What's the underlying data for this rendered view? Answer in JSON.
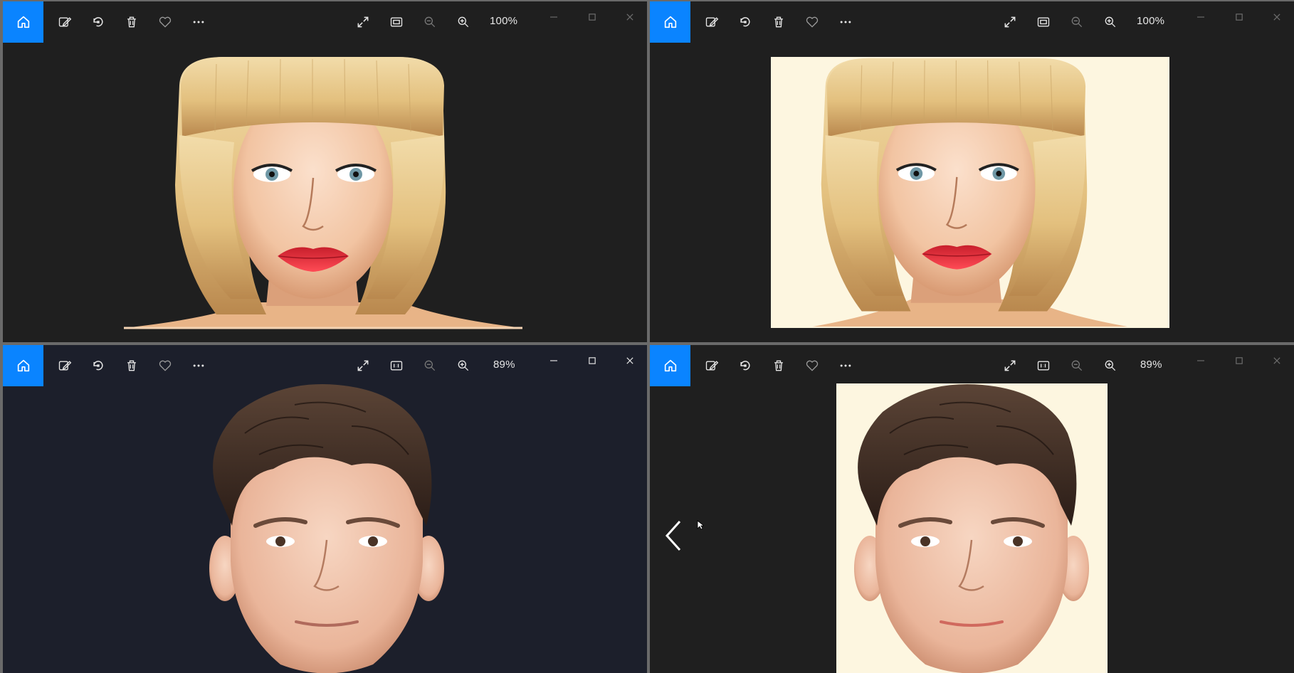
{
  "windows": [
    {
      "id": "top-left",
      "zoom": "100%",
      "background": "#1f1f1f",
      "photo_background": "none",
      "subject": "blonde woman bob haircut",
      "max_style": "dim"
    },
    {
      "id": "top-right",
      "zoom": "100%",
      "background": "#1f1f1f",
      "photo_background": "#fdf6e0",
      "subject": "blonde woman bob haircut",
      "max_style": "dim"
    },
    {
      "id": "bottom-left",
      "zoom": "89%",
      "background": "#1c1f2b",
      "photo_background": "none",
      "subject": "young man brown hair",
      "max_style": "bright"
    },
    {
      "id": "bottom-right",
      "zoom": "89%",
      "background": "#1f1f1f",
      "photo_background": "#fdf6e0",
      "subject": "young man brown hair",
      "max_style": "dim"
    }
  ],
  "toolbar": {
    "icons": [
      "home-icon",
      "edit-image-icon",
      "rotate-icon",
      "delete-icon",
      "favorite-icon",
      "more-icon",
      "fullscreen-icon",
      "fit-icon",
      "zoom-out-icon",
      "zoom-in-icon"
    ]
  },
  "colors": {
    "accent": "#0a84ff",
    "cream": "#fdf6e0",
    "lips": "#e8343f",
    "hair_blonde": "#e9cc8e",
    "hair_brown": "#3d2a22",
    "skin": "#f2c7a4"
  }
}
